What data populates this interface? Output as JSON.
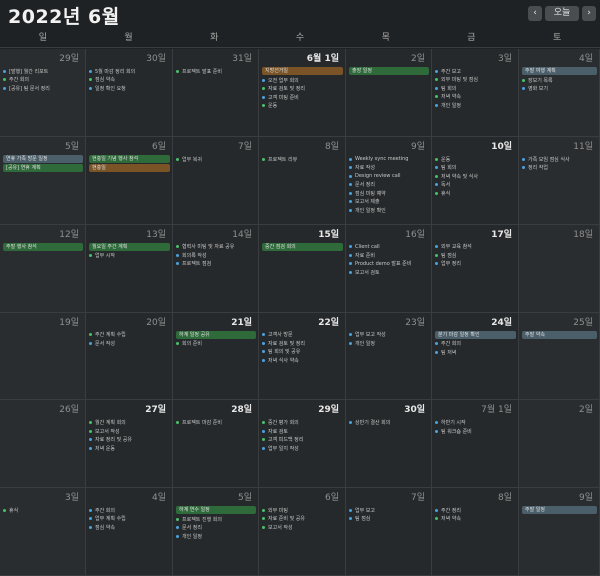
{
  "header": {
    "title": "2022년 6월",
    "prev": "‹",
    "today": "오늘",
    "next": "›"
  },
  "weekdays": [
    "일",
    "월",
    "화",
    "수",
    "목",
    "금",
    "토"
  ],
  "colors": {
    "blue": "#4aa3df",
    "green": "#49c16a",
    "orange": "#e08a3a",
    "purple": "#9b7be0"
  },
  "days": [
    {
      "num": "29일",
      "bold": false,
      "bars": [],
      "events": [
        {
          "c": "blue",
          "t": "[발행] 월간 리포트"
        },
        {
          "c": "green",
          "t": "주간 회의"
        },
        {
          "c": "blue",
          "t": "[공유] 팀 문서 정리"
        }
      ]
    },
    {
      "num": "30일",
      "bold": false,
      "bars": [],
      "events": [
        {
          "c": "blue",
          "t": "5월 마감 정리 회의"
        },
        {
          "c": "green",
          "t": "점심 약속"
        },
        {
          "c": "blue",
          "t": "일정 확인 요청"
        }
      ]
    },
    {
      "num": "31일",
      "bold": false,
      "bars": [],
      "events": [
        {
          "c": "green",
          "t": "프로젝트 발표 준비"
        }
      ]
    },
    {
      "num": "6월 1일",
      "bold": true,
      "bars": [
        {
          "c": "brown",
          "t": "지방선거일"
        }
      ],
      "events": [
        {
          "c": "blue",
          "t": "오전 업무 회의"
        },
        {
          "c": "green",
          "t": "자료 검토 및 정리"
        },
        {
          "c": "blue",
          "t": "고객 미팅 준비"
        },
        {
          "c": "green",
          "t": "운동"
        }
      ]
    },
    {
      "num": "2일",
      "bold": false,
      "bars": [
        {
          "c": "green",
          "t": "출장 일정"
        }
      ],
      "events": []
    },
    {
      "num": "3일",
      "bold": false,
      "bars": [],
      "events": [
        {
          "c": "blue",
          "t": "주간 보고"
        },
        {
          "c": "green",
          "t": "외부 미팅 및 점심"
        },
        {
          "c": "blue",
          "t": "팀 회의"
        },
        {
          "c": "green",
          "t": "저녁 약속"
        },
        {
          "c": "blue",
          "t": "개인 일정"
        }
      ]
    },
    {
      "num": "4일",
      "bold": false,
      "bars": [
        {
          "c": "blue",
          "t": "주말 여행 계획"
        }
      ],
      "events": [
        {
          "c": "green",
          "t": "장보기 목록"
        },
        {
          "c": "blue",
          "t": "영화 보기"
        }
      ]
    },
    {
      "num": "5일",
      "bold": false,
      "bars": [
        {
          "c": "blue",
          "t": "연휴 가족 방문 일정"
        },
        {
          "c": "green",
          "t": "[공유] 연휴 계획"
        }
      ],
      "events": []
    },
    {
      "num": "6일",
      "bold": false,
      "bars": [
        {
          "c": "green",
          "t": "현충일 기념 행사 참석"
        },
        {
          "c": "brown",
          "t": "현충일"
        }
      ],
      "events": []
    },
    {
      "num": "7일",
      "bold": false,
      "bars": [],
      "events": [
        {
          "c": "green",
          "t": "업무 복귀"
        }
      ]
    },
    {
      "num": "8일",
      "bold": false,
      "bars": [],
      "events": [
        {
          "c": "green",
          "t": "프로젝트 리뷰"
        }
      ]
    },
    {
      "num": "9일",
      "bold": false,
      "bars": [],
      "events": [
        {
          "c": "blue",
          "t": "Weekly sync meeting"
        },
        {
          "c": "blue",
          "t": "자료 작성"
        },
        {
          "c": "blue",
          "t": "Design review call"
        },
        {
          "c": "blue",
          "t": "문서 정리"
        },
        {
          "c": "blue",
          "t": "점심 미팅 예약"
        },
        {
          "c": "blue",
          "t": "보고서 제출"
        },
        {
          "c": "blue",
          "t": "개인 일정 확인"
        }
      ]
    },
    {
      "num": "10일",
      "bold": true,
      "bars": [],
      "events": [
        {
          "c": "green",
          "t": "운동"
        },
        {
          "c": "blue",
          "t": "팀 회의"
        },
        {
          "c": "green",
          "t": "저녁 약속 및 식사"
        },
        {
          "c": "blue",
          "t": "독서"
        },
        {
          "c": "green",
          "t": "휴식"
        }
      ]
    },
    {
      "num": "11일",
      "bold": false,
      "bars": [],
      "events": [
        {
          "c": "blue",
          "t": "가족 모임 점심 식사"
        },
        {
          "c": "blue",
          "t": "정리 작업"
        }
      ]
    },
    {
      "num": "12일",
      "bold": false,
      "bars": [
        {
          "c": "green",
          "t": "주말 행사 참석"
        }
      ],
      "events": []
    },
    {
      "num": "13일",
      "bold": false,
      "bars": [
        {
          "c": "green",
          "t": "월요일 주간 계획"
        }
      ],
      "events": [
        {
          "c": "green",
          "t": "업무 시작"
        }
      ]
    },
    {
      "num": "14일",
      "bold": false,
      "bars": [],
      "events": [
        {
          "c": "green",
          "t": "협력사 미팅 및 자료 공유"
        },
        {
          "c": "blue",
          "t": "회의록 작성"
        },
        {
          "c": "blue",
          "t": "프로젝트 점검"
        }
      ]
    },
    {
      "num": "15일",
      "bold": true,
      "bars": [
        {
          "c": "green",
          "t": "중간 점검 회의"
        }
      ],
      "events": []
    },
    {
      "num": "16일",
      "bold": false,
      "bars": [],
      "events": [
        {
          "c": "blue",
          "t": "Client call"
        },
        {
          "c": "blue",
          "t": "자료 준비"
        },
        {
          "c": "blue",
          "t": "Product demo 발표 준비"
        },
        {
          "c": "blue",
          "t": "보고서 검토"
        }
      ]
    },
    {
      "num": "17일",
      "bold": true,
      "bars": [],
      "events": [
        {
          "c": "blue",
          "t": "외부 교육 참석"
        },
        {
          "c": "green",
          "t": "팀 점심"
        },
        {
          "c": "blue",
          "t": "업무 정리"
        }
      ]
    },
    {
      "num": "18일",
      "bold": false,
      "bars": [],
      "events": []
    },
    {
      "num": "19일",
      "bold": false,
      "bars": [],
      "events": []
    },
    {
      "num": "20일",
      "bold": false,
      "bars": [],
      "events": [
        {
          "c": "green",
          "t": "주간 계획 수립"
        },
        {
          "c": "blue",
          "t": "문서 작성"
        }
      ]
    },
    {
      "num": "21일",
      "bold": true,
      "bars": [
        {
          "c": "green",
          "t": "하계 일정 공유"
        }
      ],
      "events": [
        {
          "c": "green",
          "t": "회의 준비"
        }
      ]
    },
    {
      "num": "22일",
      "bold": true,
      "bars": [],
      "events": [
        {
          "c": "blue",
          "t": "고객사 방문"
        },
        {
          "c": "blue",
          "t": "자료 검토 및 정리"
        },
        {
          "c": "blue",
          "t": "팀 회의 및 공유"
        },
        {
          "c": "blue",
          "t": "저녁 식사 약속"
        }
      ]
    },
    {
      "num": "23일",
      "bold": false,
      "bars": [],
      "events": [
        {
          "c": "blue",
          "t": "업무 보고 작성"
        },
        {
          "c": "blue",
          "t": "개인 일정"
        }
      ]
    },
    {
      "num": "24일",
      "bold": true,
      "bars": [
        {
          "c": "blue",
          "t": "분기 마감 일정 확인"
        }
      ],
      "events": [
        {
          "c": "blue",
          "t": "주간 회의"
        },
        {
          "c": "blue",
          "t": "팀 저녁"
        }
      ]
    },
    {
      "num": "25일",
      "bold": false,
      "bars": [
        {
          "c": "blue",
          "t": "주말 약속"
        }
      ],
      "events": []
    },
    {
      "num": "26일",
      "bold": false,
      "bars": [],
      "events": []
    },
    {
      "num": "27일",
      "bold": true,
      "bars": [],
      "events": [
        {
          "c": "green",
          "t": "월간 계획 회의"
        },
        {
          "c": "green",
          "t": "보고서 작성"
        },
        {
          "c": "blue",
          "t": "자료 정리 및 공유"
        },
        {
          "c": "blue",
          "t": "저녁 운동"
        }
      ]
    },
    {
      "num": "28일",
      "bold": true,
      "bars": [],
      "events": [
        {
          "c": "green",
          "t": "프로젝트 마감 준비"
        }
      ]
    },
    {
      "num": "29일",
      "bold": true,
      "bars": [],
      "events": [
        {
          "c": "green",
          "t": "중간 평가 회의"
        },
        {
          "c": "blue",
          "t": "자료 검토"
        },
        {
          "c": "green",
          "t": "고객 피드백 정리"
        },
        {
          "c": "blue",
          "t": "업무 일지 작성"
        }
      ]
    },
    {
      "num": "30일",
      "bold": true,
      "bars": [],
      "events": [
        {
          "c": "blue",
          "t": "상반기 결산 회의"
        }
      ]
    },
    {
      "num": "7월 1일",
      "bold": false,
      "bars": [],
      "events": [
        {
          "c": "blue",
          "t": "하반기 시작"
        },
        {
          "c": "blue",
          "t": "팀 워크숍 준비"
        }
      ]
    },
    {
      "num": "2일",
      "bold": false,
      "bars": [],
      "events": []
    },
    {
      "num": "3일",
      "bold": false,
      "bars": [],
      "events": [
        {
          "c": "green",
          "t": "휴식"
        }
      ]
    },
    {
      "num": "4일",
      "bold": false,
      "bars": [],
      "events": [
        {
          "c": "blue",
          "t": "주간 회의"
        },
        {
          "c": "blue",
          "t": "업무 계획 수립"
        },
        {
          "c": "blue",
          "t": "점심 약속"
        }
      ]
    },
    {
      "num": "5일",
      "bold": false,
      "bars": [
        {
          "c": "green",
          "t": "하계 연수 일정"
        }
      ],
      "events": [
        {
          "c": "green",
          "t": "프로젝트 진행 회의"
        },
        {
          "c": "blue",
          "t": "문서 정리"
        },
        {
          "c": "blue",
          "t": "개인 일정"
        }
      ]
    },
    {
      "num": "6일",
      "bold": false,
      "bars": [],
      "events": [
        {
          "c": "green",
          "t": "외부 미팅"
        },
        {
          "c": "green",
          "t": "자료 준비 및 공유"
        },
        {
          "c": "green",
          "t": "보고서 작성"
        }
      ]
    },
    {
      "num": "7일",
      "bold": false,
      "bars": [],
      "events": [
        {
          "c": "blue",
          "t": "업무 보고"
        },
        {
          "c": "blue",
          "t": "팀 점심"
        }
      ]
    },
    {
      "num": "8일",
      "bold": false,
      "bars": [],
      "events": [
        {
          "c": "blue",
          "t": "주간 정리"
        },
        {
          "c": "green",
          "t": "저녁 약속"
        }
      ]
    },
    {
      "num": "9일",
      "bold": false,
      "bars": [
        {
          "c": "blue",
          "t": "주말 일정"
        }
      ],
      "events": []
    }
  ]
}
